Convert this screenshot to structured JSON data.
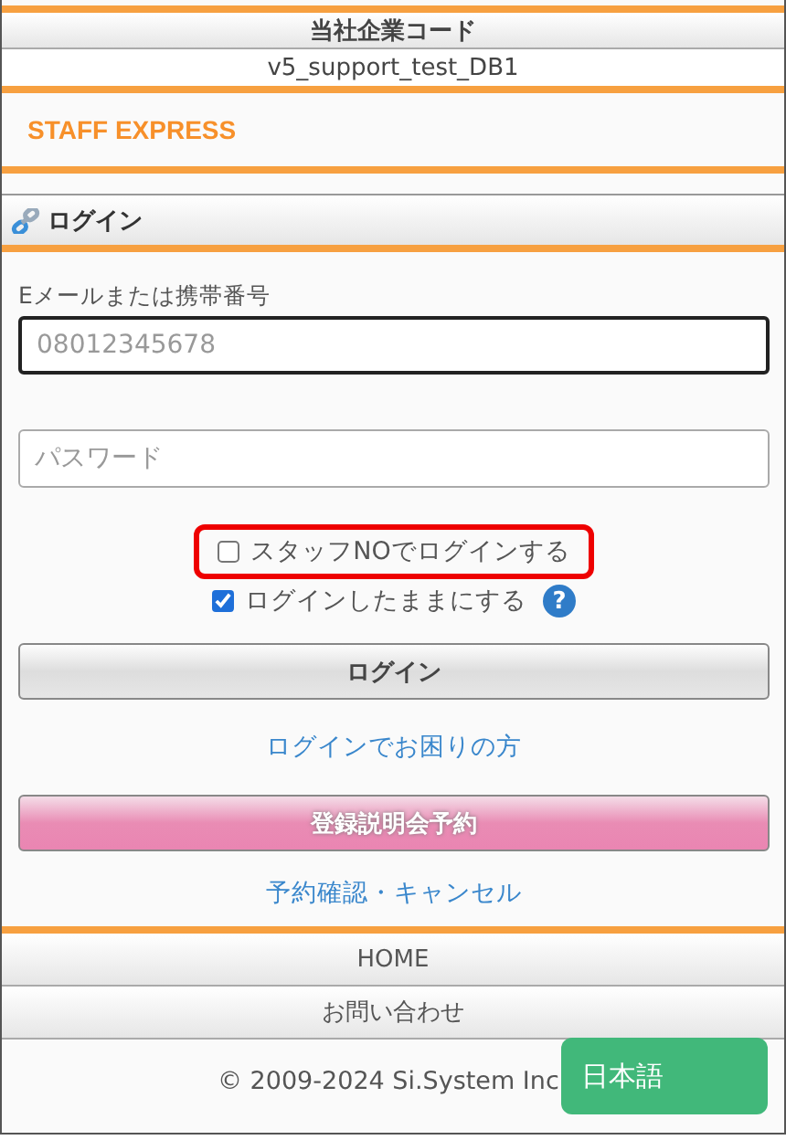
{
  "company_code": {
    "label": "当社企業コード",
    "value": "v5_support_test_DB1"
  },
  "brand": "STAFF EXPRESS",
  "section": {
    "title": "ログイン"
  },
  "email": {
    "label": "Eメールまたは携帯番号",
    "placeholder": "08012345678",
    "focused": true
  },
  "password": {
    "placeholder": "パスワード"
  },
  "options": [
    {
      "label": "スタッフNOでログインする",
      "checked": false,
      "highlighted": true
    },
    {
      "label": "ログインしたままにする",
      "checked": true,
      "highlighted": false,
      "help": "?"
    }
  ],
  "login_button": "ログイン",
  "help_link": "ログインでお困りの方",
  "reserve_button": "登録説明会予約",
  "reserve_link": "予約確認・キャンセル",
  "nav": [
    {
      "label": "HOME"
    },
    {
      "label": "お問い合わせ"
    }
  ],
  "copyright": "© 2009-2024 Si.System Inc",
  "language_button": "日本語"
}
